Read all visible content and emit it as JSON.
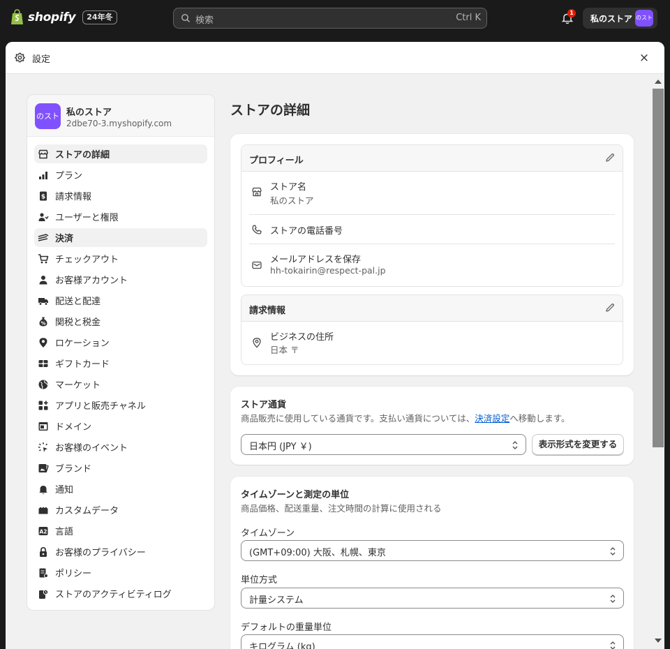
{
  "topbar": {
    "brand": "shopify",
    "edition_badge": "24年冬",
    "search_placeholder": "検索",
    "search_shortcut": "Ctrl K",
    "notification_count": "1",
    "store_label": "私のストア",
    "store_avatar_text": "のスト"
  },
  "modal": {
    "title": "設定",
    "close_label": "×"
  },
  "sidebar": {
    "store_avatar_text": "のスト",
    "store_name": "私のストア",
    "store_domain": "2dbe70-3.myshopify.com",
    "items": [
      {
        "label": "ストアの詳細",
        "icon": "store-icon",
        "active": true
      },
      {
        "label": "プラン",
        "icon": "plan-icon",
        "active": false
      },
      {
        "label": "請求情報",
        "icon": "billing-icon",
        "active": false
      },
      {
        "label": "ユーザーと権限",
        "icon": "users-icon",
        "active": false
      },
      {
        "label": "決済",
        "icon": "payments-icon",
        "active": true
      },
      {
        "label": "チェックアウト",
        "icon": "cart-icon",
        "active": false
      },
      {
        "label": "お客様アカウント",
        "icon": "person-icon",
        "active": false
      },
      {
        "label": "配送と配達",
        "icon": "truck-icon",
        "active": false
      },
      {
        "label": "関税と税金",
        "icon": "tax-icon",
        "active": false
      },
      {
        "label": "ロケーション",
        "icon": "location-icon",
        "active": false
      },
      {
        "label": "ギフトカード",
        "icon": "gift-card-icon",
        "active": false
      },
      {
        "label": "マーケット",
        "icon": "globe-icon",
        "active": false
      },
      {
        "label": "アプリと販売チャネル",
        "icon": "apps-icon",
        "active": false
      },
      {
        "label": "ドメイン",
        "icon": "domain-icon",
        "active": false
      },
      {
        "label": "お客様のイベント",
        "icon": "cursor-icon",
        "active": false
      },
      {
        "label": "ブランド",
        "icon": "brand-icon",
        "active": false
      },
      {
        "label": "通知",
        "icon": "bell-icon",
        "active": false
      },
      {
        "label": "カスタムデータ",
        "icon": "custom-data-icon",
        "active": false
      },
      {
        "label": "言語",
        "icon": "language-icon",
        "active": false
      },
      {
        "label": "お客様のプライバシー",
        "icon": "lock-icon",
        "active": false
      },
      {
        "label": "ポリシー",
        "icon": "policy-icon",
        "active": false
      },
      {
        "label": "ストアのアクティビティログ",
        "icon": "activity-log-icon",
        "active": false
      }
    ]
  },
  "main": {
    "page_title": "ストアの詳細",
    "profile": {
      "title": "プロフィール",
      "store_name_label": "ストア名",
      "store_name_value": "私のストア",
      "phone_label": "ストアの電話番号",
      "email_label": "メールアドレスを保存",
      "email_value": "hh-tokairin@respect-pal.jp"
    },
    "billing": {
      "title": "請求情報",
      "address_label": "ビジネスの住所",
      "address_value": "日本 〒"
    },
    "currency": {
      "title": "ストア通貨",
      "desc_before": "商品販売に使用している通貨です。支払い通貨については、",
      "desc_link": "決済設定",
      "desc_after": "へ移動します。",
      "select_value": "日本円 (JPY ￥)",
      "change_button": "表示形式を変更する"
    },
    "timezone": {
      "title": "タイムゾーンと測定の単位",
      "desc": "商品価格、配送重量、注文時間の計算に使用される",
      "tz_label": "タイムゾーン",
      "tz_value": "(GMT+09:00) 大阪、札幌、東京",
      "unit_label": "単位方式",
      "unit_value": "計量システム",
      "weight_label": "デフォルトの重量単位",
      "weight_value": "キログラム (kg)"
    }
  },
  "colors": {
    "accent": "#8051ff",
    "link": "#005bd3",
    "badge": "#e51c00"
  }
}
